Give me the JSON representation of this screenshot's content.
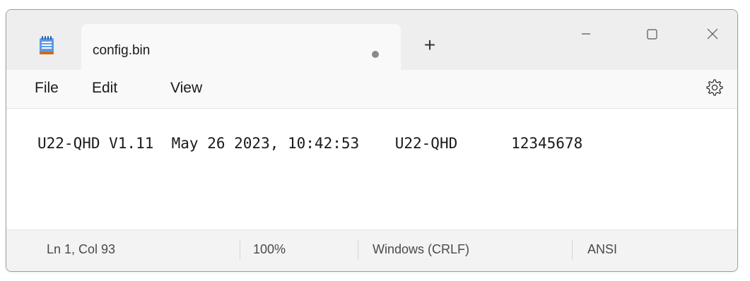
{
  "tab": {
    "title": "config.bin",
    "new_tab_label": "+"
  },
  "icons": {
    "app": "notepad-icon",
    "unsaved": "unsaved-dot-icon",
    "settings": "gear-icon",
    "minimize": "minimize-icon",
    "maximize": "maximize-icon",
    "close": "close-icon"
  },
  "menu": {
    "file": "File",
    "edit": "Edit",
    "view": "View"
  },
  "editor": {
    "content": "U22-QHD V1.11  May 26 2023, 10:42:53    U22-QHD      12345678"
  },
  "status": {
    "position": "Ln 1, Col 93",
    "zoom": "100%",
    "line_ending": "Windows (CRLF)",
    "encoding": "ANSI"
  },
  "colors": {
    "titlebar": "#eeeeee",
    "tab": "#f9f9f9",
    "statusbar": "#f3f3f3",
    "icon_accent": "#3c7fd6"
  }
}
